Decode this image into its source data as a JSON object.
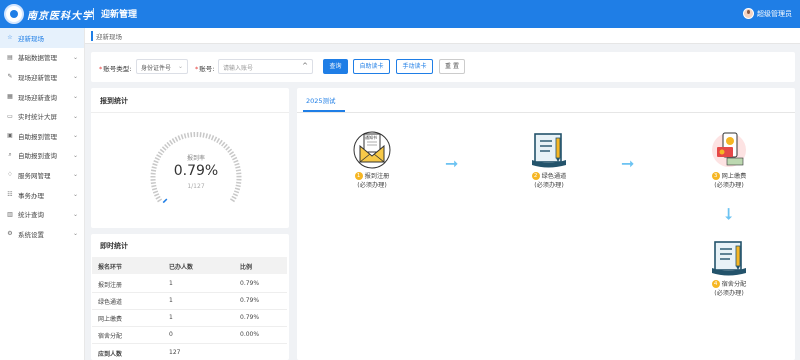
{
  "header": {
    "school_name": "南京医科大学",
    "system_title": "迎新管理",
    "user_name": "超级管理员"
  },
  "sidebar": {
    "items": [
      {
        "icon": "star-icon",
        "glyph": "☆",
        "label": "迎新现场",
        "active": true,
        "chevron": false
      },
      {
        "icon": "document-icon",
        "glyph": "▤",
        "label": "基础数据管理",
        "active": false,
        "chevron": true
      },
      {
        "icon": "edit-icon",
        "glyph": "✎",
        "label": "现场迎新管理",
        "active": false,
        "chevron": true
      },
      {
        "icon": "grid-icon",
        "glyph": "▦",
        "label": "现场迎新查询",
        "active": false,
        "chevron": true
      },
      {
        "icon": "monitor-icon",
        "glyph": "▭",
        "label": "实时统计大屏",
        "active": false,
        "chevron": true
      },
      {
        "icon": "calendar-icon",
        "glyph": "▣",
        "label": "自助报到管理",
        "active": false,
        "chevron": true
      },
      {
        "icon": "search-icon",
        "glyph": "⌕",
        "label": "自助报到查询",
        "active": false,
        "chevron": true
      },
      {
        "icon": "service-icon",
        "glyph": "♢",
        "label": "服务网管理",
        "active": false,
        "chevron": true
      },
      {
        "icon": "task-icon",
        "glyph": "☷",
        "label": "事务办理",
        "active": false,
        "chevron": true
      },
      {
        "icon": "chart-icon",
        "glyph": "▥",
        "label": "统计查询",
        "active": false,
        "chevron": true
      },
      {
        "icon": "gear-icon",
        "glyph": "⚙",
        "label": "系统设置",
        "active": false,
        "chevron": true
      }
    ]
  },
  "tab": {
    "label": "迎新现场"
  },
  "search": {
    "type_label": "账号类型:",
    "type_value": "身份证件号",
    "account_label": "账号:",
    "account_placeholder": "请输入账号",
    "query_label": "查询",
    "auto_card_label": "自助读卡",
    "manual_card_label": "手动读卡",
    "reset_label": "重 置"
  },
  "report_stats": {
    "title": "报到统计",
    "rate_caption": "报到率",
    "rate_value": "0.79%",
    "rate_fraction": "1/127",
    "rate_percent": 0.79
  },
  "live_stats": {
    "title": "即时统计",
    "headers": [
      "报名环节",
      "已办人数",
      "比例"
    ],
    "rows": [
      [
        "报到注册",
        "1",
        "0.79%"
      ],
      [
        "绿色通道",
        "1",
        "0.79%"
      ],
      [
        "网上缴费",
        "1",
        "0.79%"
      ],
      [
        "宿舍分配",
        "0",
        "0.00%"
      ]
    ],
    "total_label": "应到人数",
    "total_value": "127"
  },
  "flow": {
    "tab_label": "2025测试",
    "steps": [
      {
        "num": "1",
        "name": "报到注册",
        "note": "(必须办理)",
        "icon": "envelope-notice-icon"
      },
      {
        "num": "2",
        "name": "绿色通道",
        "note": "(必须办理)",
        "icon": "book-pen-icon"
      },
      {
        "num": "3",
        "name": "网上缴费",
        "note": "(必须办理)",
        "icon": "phone-payment-icon"
      },
      {
        "num": "4",
        "name": "宿舍分配",
        "note": "(必须办理)",
        "icon": "book-pen-icon"
      }
    ],
    "notice_icon_text": "通知书"
  },
  "colors": {
    "primary": "#1f7ee6",
    "arrow": "#6cc3f2",
    "badge": "#f6b623",
    "sidebar_active_bg": "#e6f1fc"
  }
}
